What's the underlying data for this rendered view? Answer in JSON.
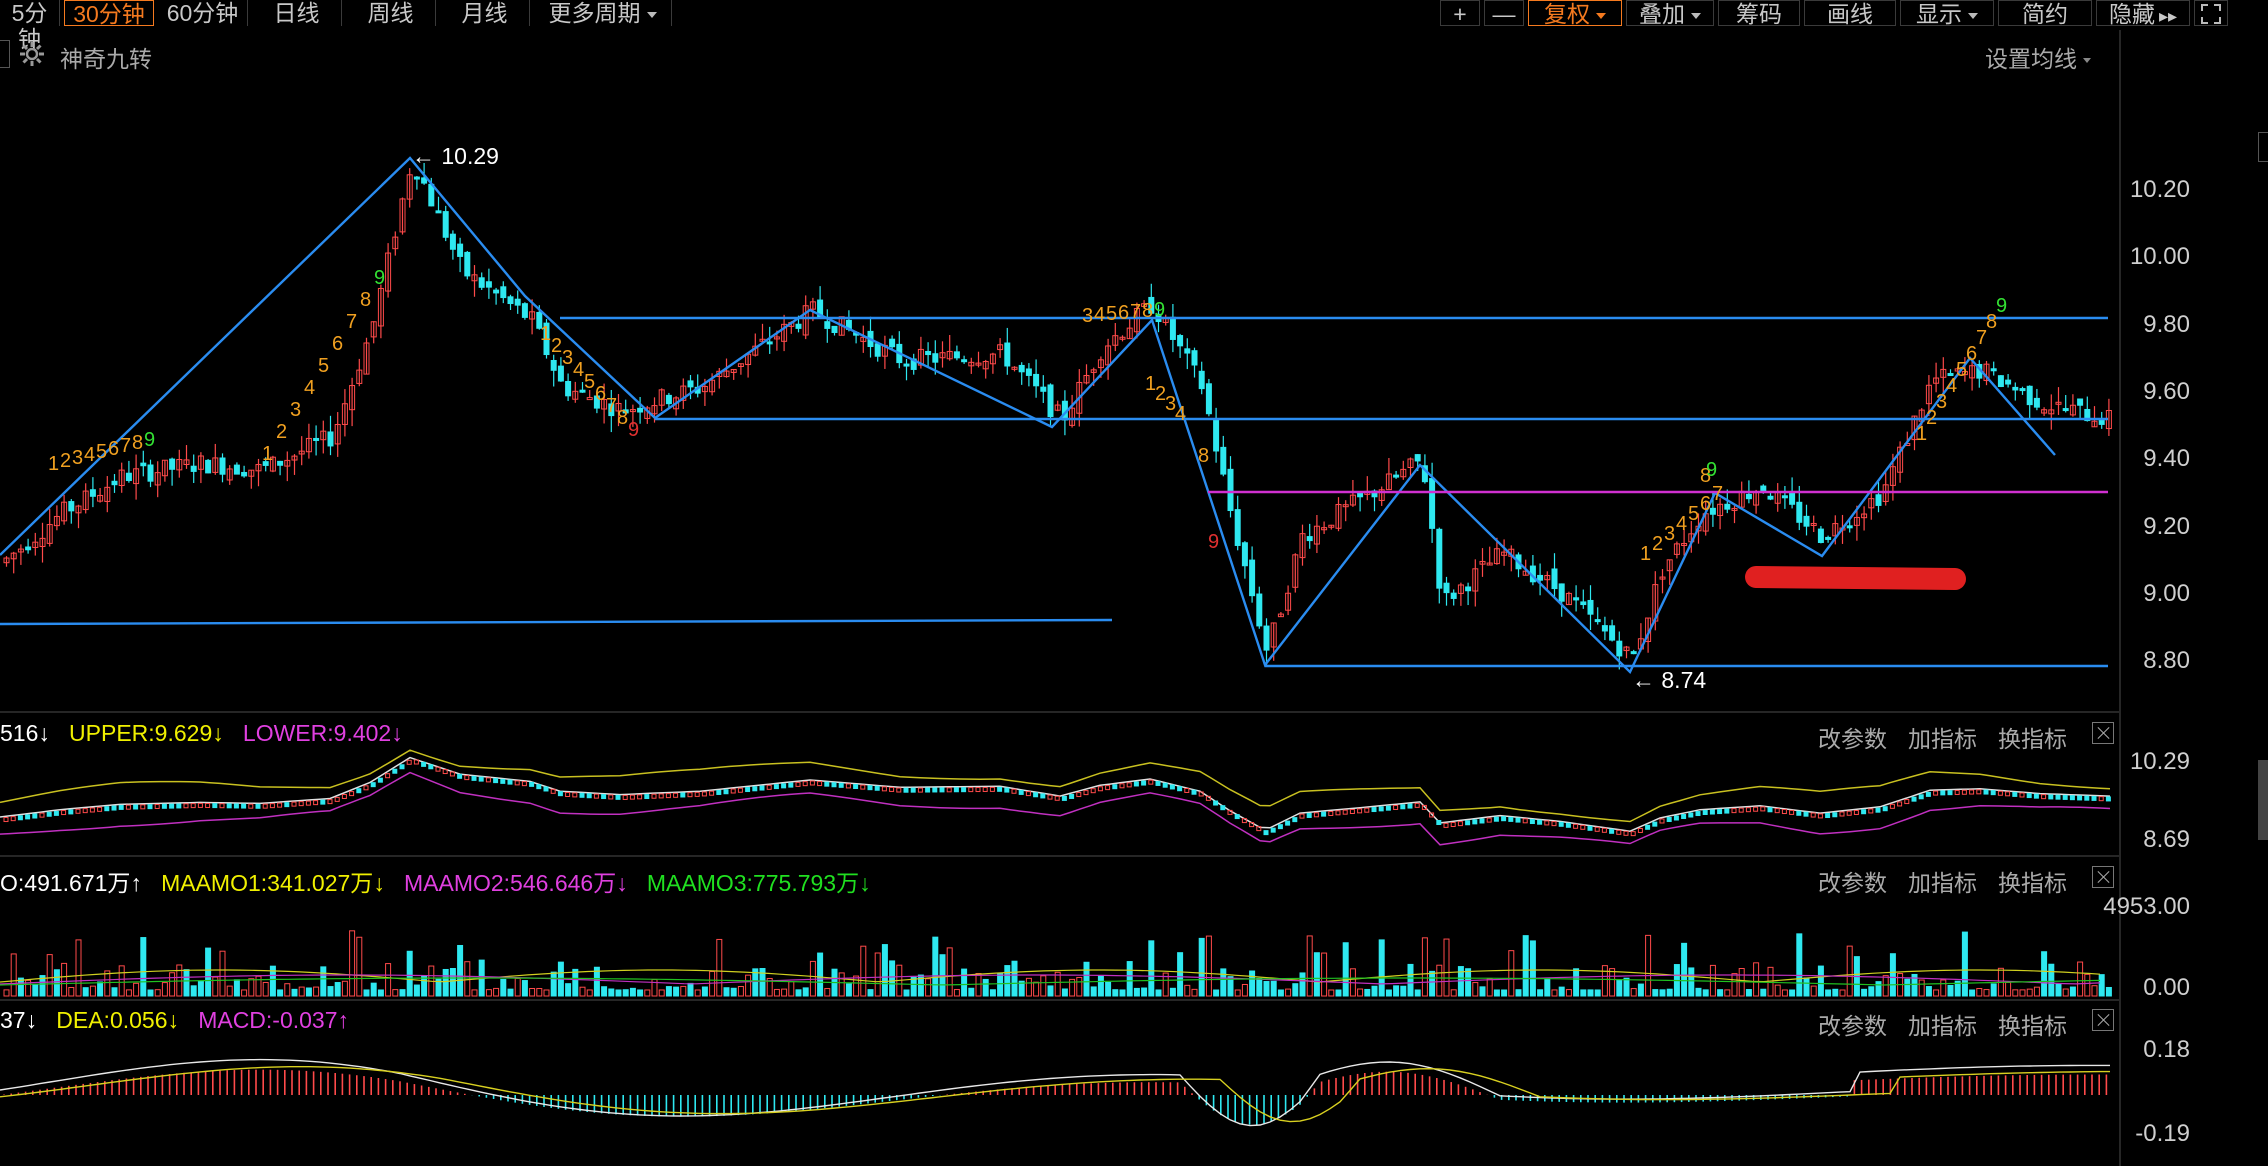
{
  "toolbar": {
    "periods": [
      "5分钟",
      "30分钟",
      "60分钟",
      "日线",
      "周线",
      "月线",
      "更多周期"
    ],
    "active_period": "30分钟",
    "right_buttons": [
      "+",
      "—",
      "复权",
      "叠加",
      "筹码",
      "画线",
      "显示",
      "简约",
      "隐藏"
    ],
    "active_right": "复权"
  },
  "subheader": {
    "indicator_name": "神奇九转",
    "ma_setting": "设置均线"
  },
  "main_chart": {
    "high_label": "10.29",
    "low_label": "8.74",
    "price_ticks": [
      "10.20",
      "10.00",
      "9.80",
      "9.60",
      "9.40",
      "9.20",
      "9.00",
      "8.80"
    ]
  },
  "boll_panel": {
    "legend": [
      {
        "text": "516",
        "arrow": "↓",
        "color": "#ffffff"
      },
      {
        "text": "UPPER:9.629",
        "arrow": "↓",
        "color": "#f0f000"
      },
      {
        "text": "LOWER:9.402",
        "arrow": "↓",
        "color": "#e040e0"
      }
    ],
    "ticks": [
      "10.29",
      "8.69"
    ]
  },
  "vol_panel": {
    "legend": [
      {
        "text": "O:491.671万",
        "arrow": "↑",
        "color": "#ffffff"
      },
      {
        "text": "MAAMO1:341.027万",
        "arrow": "↓",
        "color": "#f0f000"
      },
      {
        "text": "MAAMO2:546.646万",
        "arrow": "↓",
        "color": "#e040e0"
      },
      {
        "text": "MAAMO3:775.793万",
        "arrow": "↓",
        "color": "#20e020"
      }
    ],
    "ticks": [
      "4953.00",
      "0.00"
    ]
  },
  "macd_panel": {
    "legend": [
      {
        "text": "37",
        "arrow": "↓",
        "color": "#ffffff"
      },
      {
        "text": "DEA:0.056",
        "arrow": "↓",
        "color": "#f0f000"
      },
      {
        "text": "MACD:-0.037",
        "arrow": "↑",
        "color": "#e040e0"
      }
    ],
    "ticks": [
      "0.18",
      "-0.19"
    ]
  },
  "panel_buttons": [
    "改参数",
    "加指标",
    "换指标"
  ],
  "colors": {
    "up": "#ff4a4a",
    "down": "#2ee8f0",
    "trend": "#2a8cf0",
    "level_magenta": "#d030d0",
    "highlight": "#e02020"
  }
}
